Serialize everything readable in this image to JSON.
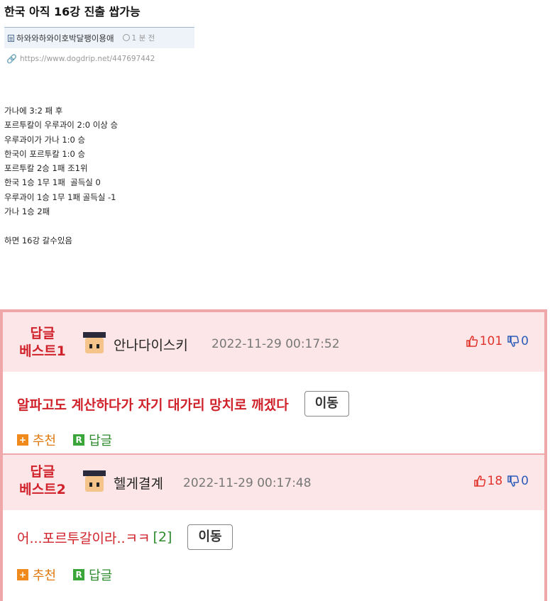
{
  "post": {
    "title": "한국 아직 16강 진출 쌉가능",
    "author": "하와와하와이호박달팽이용애",
    "time": "1 분 전",
    "url": "https://www.dogdrip.net/447697442",
    "lines": [
      "가나에 3:2 패 후",
      "포르투칼이 우루과이 2:0 이상 승",
      "우루과이가 가나 1:0 승",
      "한국이 포르투칼 1:0 승",
      "포르투칼 2승 1패 조1위",
      "한국 1승 1무 1패  골득실 0",
      "우루과이 1승 1무 1패 골득실 -1",
      "가나 1승 2패",
      "",
      "하면 16강 갈수있음"
    ]
  },
  "comments": [
    {
      "label_line1": "답글",
      "label_line2": "베스트1",
      "nickname": "안나다이스키",
      "datetime": "2022-11-29 00:17:52",
      "upvotes": "101",
      "downvotes": "0",
      "text": "알파고도 계산하다가 자기 대가리 망치로 깨겠다",
      "reply_count": "",
      "move_label": "이동",
      "recommend_label": "추천",
      "reply_label": "답글"
    },
    {
      "label_line1": "답글",
      "label_line2": "베스트2",
      "nickname": "헬게결계",
      "datetime": "2022-11-29 00:17:48",
      "upvotes": "18",
      "downvotes": "0",
      "text": "어...포르투갈이라..ㅋㅋ",
      "reply_count": "[2]",
      "move_label": "이동",
      "recommend_label": "추천",
      "reply_label": "답글"
    }
  ],
  "colors": {
    "accent_red": "#d0222b",
    "best_bg": "#fde6e8",
    "best_border": "#f0a7aa",
    "upvote": "#e0332b",
    "downvote": "#2d5bb8",
    "reply_green": "#2e8b2e",
    "recommend_orange": "#f08a1c"
  },
  "icons": [
    "doc-icon",
    "clock-icon",
    "link-icon",
    "avatar",
    "thumbs-up-icon",
    "thumbs-down-icon",
    "plus-icon",
    "reply-icon"
  ]
}
